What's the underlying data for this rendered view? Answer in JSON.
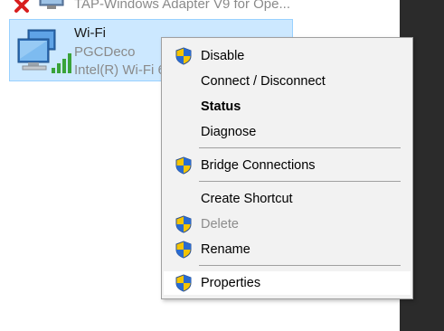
{
  "top_adapter": {
    "label": "TAP-Windows Adapter V9 for Ope...",
    "status_icon": "red-x-icon",
    "device_icon": "network-adapter-icon"
  },
  "wifi_adapter": {
    "name": "Wi-Fi",
    "ssid": "PGCDeco",
    "device": "Intel(R) Wi-Fi 6",
    "icon": "wifi-adapter-icon"
  },
  "context_menu": {
    "items": [
      {
        "label": "Disable",
        "shield": true,
        "bold": false,
        "disabled": false
      },
      {
        "label": "Connect / Disconnect",
        "shield": false,
        "bold": false,
        "disabled": false
      },
      {
        "label": "Status",
        "shield": false,
        "bold": true,
        "disabled": false
      },
      {
        "label": "Diagnose",
        "shield": false,
        "bold": false,
        "disabled": false
      },
      {
        "label": "Bridge Connections",
        "shield": true,
        "bold": false,
        "disabled": false
      },
      {
        "label": "Create Shortcut",
        "shield": false,
        "bold": false,
        "disabled": false
      },
      {
        "label": "Delete",
        "shield": true,
        "bold": false,
        "disabled": true
      },
      {
        "label": "Rename",
        "shield": true,
        "bold": false,
        "disabled": false
      },
      {
        "label": "Properties",
        "shield": true,
        "bold": false,
        "disabled": false,
        "highlighted": true
      }
    ]
  },
  "colors": {
    "selection_bg": "#cce8ff",
    "selection_border": "#99d1ff",
    "menu_bg": "#f2f2f2"
  }
}
